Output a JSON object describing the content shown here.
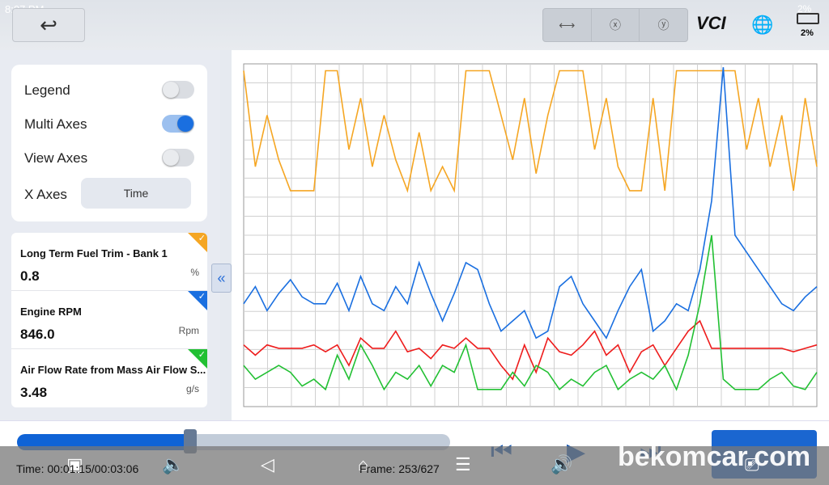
{
  "status_bar": {
    "time": "8:07 PM",
    "battery_top": "2%"
  },
  "toolbar": {
    "tools": [
      "fit-icon",
      "zoom-x-icon",
      "zoom-y-icon"
    ],
    "vci": "VCI",
    "battery": "2%"
  },
  "settings": {
    "legend": {
      "label": "Legend",
      "on": false
    },
    "multi_axes": {
      "label": "Multi Axes",
      "on": true
    },
    "view_axes": {
      "label": "View Axes",
      "on": false
    },
    "x_axes": {
      "label": "X Axes",
      "value": "Time"
    }
  },
  "pids": [
    {
      "name": "Long Term Fuel Trim - Bank 1",
      "value": "0.8",
      "unit": "%",
      "color": "#f5a623"
    },
    {
      "name": "Engine RPM",
      "value": "846.0",
      "unit": "Rpm",
      "color": "#1a6fe0"
    },
    {
      "name": "Air Flow Rate from Mass Air Flow S...",
      "value": "3.48",
      "unit": "g/s",
      "color": "#22c033"
    }
  ],
  "playback": {
    "progress": 0.4,
    "time": "Time: 00:01:15/00:03:06",
    "frame": "Frame: 253/627"
  },
  "watermark": "bekomcar.com",
  "chart_data": {
    "type": "line",
    "grid": true,
    "legend": "hidden",
    "ylim": [
      0,
      100
    ],
    "series": [
      {
        "color": "#f5a623",
        "values": [
          98,
          70,
          85,
          72,
          63,
          63,
          63,
          98,
          98,
          75,
          90,
          70,
          85,
          72,
          63,
          80,
          63,
          70,
          63,
          98,
          98,
          98,
          85,
          72,
          90,
          68,
          85,
          98,
          98,
          98,
          75,
          90,
          70,
          63,
          63,
          90,
          63,
          98,
          98,
          98,
          98,
          98,
          98,
          75,
          90,
          70,
          85,
          63,
          90,
          70
        ]
      },
      {
        "color": "#1a6fe0",
        "values": [
          30,
          35,
          28,
          33,
          37,
          32,
          30,
          30,
          36,
          28,
          38,
          30,
          28,
          35,
          30,
          42,
          33,
          25,
          33,
          42,
          40,
          30,
          22,
          25,
          28,
          20,
          22,
          35,
          38,
          30,
          25,
          20,
          28,
          35,
          40,
          22,
          25,
          30,
          28,
          40,
          60,
          99,
          50,
          45,
          40,
          35,
          30,
          28,
          32,
          35
        ]
      },
      {
        "color": "#ee1c1c",
        "values": [
          18,
          15,
          18,
          17,
          17,
          17,
          18,
          16,
          18,
          12,
          20,
          17,
          17,
          22,
          16,
          17,
          14,
          18,
          17,
          20,
          17,
          17,
          12,
          8,
          18,
          10,
          20,
          16,
          15,
          18,
          22,
          15,
          18,
          10,
          16,
          18,
          12,
          17,
          22,
          25,
          17,
          17,
          17,
          17,
          17,
          17,
          17,
          16,
          17,
          18
        ]
      },
      {
        "color": "#22c033",
        "values": [
          12,
          8,
          10,
          12,
          10,
          6,
          8,
          5,
          15,
          8,
          18,
          12,
          5,
          10,
          8,
          12,
          6,
          12,
          10,
          18,
          5,
          5,
          5,
          10,
          6,
          12,
          10,
          5,
          8,
          6,
          10,
          12,
          5,
          8,
          10,
          8,
          12,
          5,
          15,
          30,
          50,
          8,
          5,
          5,
          5,
          8,
          10,
          6,
          5,
          10
        ]
      }
    ]
  }
}
